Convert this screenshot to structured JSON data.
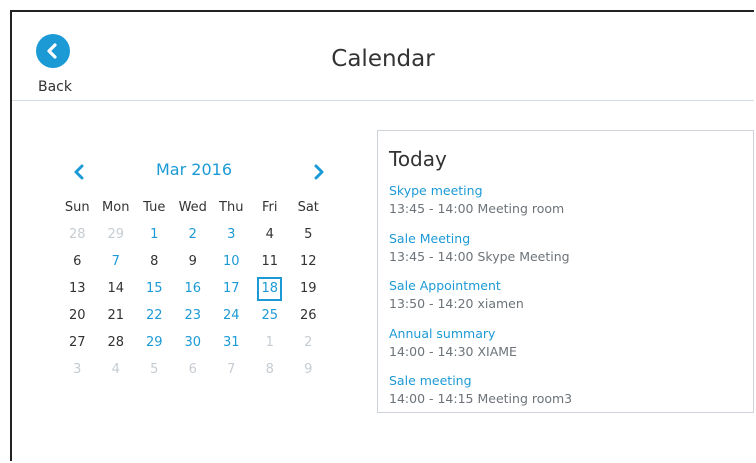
{
  "header": {
    "back_label": "Back",
    "title": "Calendar"
  },
  "calendar": {
    "month_label": "Mar 2016",
    "weekdays": [
      "Sun",
      "Mon",
      "Tue",
      "Wed",
      "Thu",
      "Fri",
      "Sat"
    ],
    "weeks": [
      [
        {
          "d": "28",
          "s": "muted"
        },
        {
          "d": "29",
          "s": "muted"
        },
        {
          "d": "1",
          "s": "event"
        },
        {
          "d": "2",
          "s": "event"
        },
        {
          "d": "3",
          "s": "event"
        },
        {
          "d": "4",
          "s": ""
        },
        {
          "d": "5",
          "s": ""
        }
      ],
      [
        {
          "d": "6",
          "s": ""
        },
        {
          "d": "7",
          "s": "event"
        },
        {
          "d": "8",
          "s": ""
        },
        {
          "d": "9",
          "s": ""
        },
        {
          "d": "10",
          "s": "event"
        },
        {
          "d": "11",
          "s": ""
        },
        {
          "d": "12",
          "s": ""
        }
      ],
      [
        {
          "d": "13",
          "s": ""
        },
        {
          "d": "14",
          "s": ""
        },
        {
          "d": "15",
          "s": "event"
        },
        {
          "d": "16",
          "s": "event"
        },
        {
          "d": "17",
          "s": "event"
        },
        {
          "d": "18",
          "s": "selected"
        },
        {
          "d": "19",
          "s": ""
        }
      ],
      [
        {
          "d": "20",
          "s": ""
        },
        {
          "d": "21",
          "s": ""
        },
        {
          "d": "22",
          "s": "event"
        },
        {
          "d": "23",
          "s": "event"
        },
        {
          "d": "24",
          "s": "event"
        },
        {
          "d": "25",
          "s": "event"
        },
        {
          "d": "26",
          "s": ""
        }
      ],
      [
        {
          "d": "27",
          "s": ""
        },
        {
          "d": "28",
          "s": ""
        },
        {
          "d": "29",
          "s": "event"
        },
        {
          "d": "30",
          "s": "event"
        },
        {
          "d": "31",
          "s": "event"
        },
        {
          "d": "1",
          "s": "muted"
        },
        {
          "d": "2",
          "s": "muted"
        }
      ],
      [
        {
          "d": "3",
          "s": "muted"
        },
        {
          "d": "4",
          "s": "muted"
        },
        {
          "d": "5",
          "s": "muted"
        },
        {
          "d": "6",
          "s": "muted"
        },
        {
          "d": "7",
          "s": "muted"
        },
        {
          "d": "8",
          "s": "muted"
        },
        {
          "d": "9",
          "s": "muted"
        }
      ]
    ]
  },
  "today": {
    "title": "Today",
    "events": [
      {
        "name": "Skype meeting",
        "time": "13:45 - 14:00 Meeting room"
      },
      {
        "name": "Sale Meeting",
        "time": "13:45 - 14:00 Skype Meeting"
      },
      {
        "name": "Sale Appointment",
        "time": "13:50 - 14:20 xiamen"
      },
      {
        "name": "Annual summary",
        "time": "14:00 - 14:30 XIAME"
      },
      {
        "name": "Sale meeting",
        "time": "14:00 - 14:15 Meeting room3"
      }
    ]
  },
  "colors": {
    "accent": "#1c9ad6",
    "muted_day": "#c6ccd1",
    "text": "#333333"
  },
  "icons": {
    "back": "chevron-left-icon",
    "prev_month": "chevron-left-icon",
    "next_month": "chevron-right-icon"
  }
}
